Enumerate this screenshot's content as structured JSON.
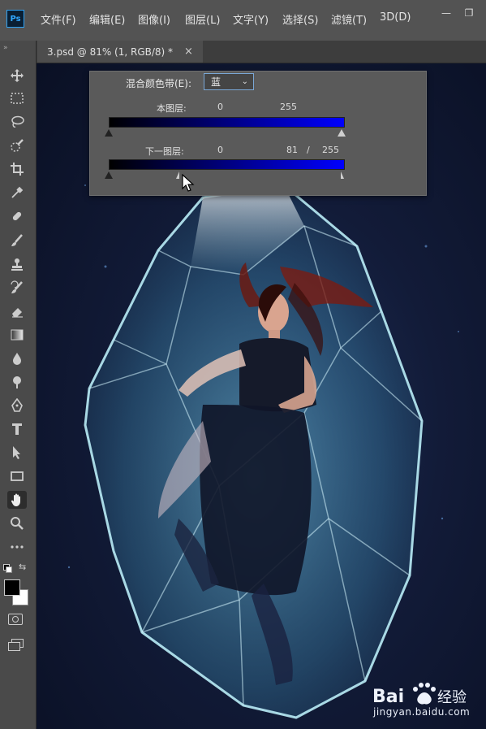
{
  "app": {
    "logo": "Ps"
  },
  "menu": {
    "items": [
      "文件(F)",
      "编辑(E)",
      "图像(I)",
      "图层(L)",
      "文字(Y)",
      "选择(S)",
      "滤镜(T)",
      "3D(D)"
    ]
  },
  "window_controls": {
    "minimize": "—",
    "restore": "❐"
  },
  "tabs": [
    {
      "label": "3.psd @ 81% (1, RGB/8) *",
      "close": "×"
    }
  ],
  "toolbar": {
    "expand": "»",
    "tools": [
      "move-icon",
      "marquee-icon",
      "lasso-icon",
      "quick-select-icon",
      "crop-icon",
      "eyedropper-icon",
      "healing-brush-icon",
      "brush-icon",
      "stamp-icon",
      "history-brush-icon",
      "eraser-icon",
      "gradient-icon",
      "blur-icon",
      "dodge-icon",
      "pen-icon",
      "type-icon",
      "path-select-icon",
      "rectangle-icon",
      "hand-icon",
      "zoom-icon",
      "more-icon"
    ],
    "active_tool": "hand-icon",
    "foreground_color": "#000000",
    "background_color": "#ffffff"
  },
  "blend_if": {
    "label": "混合颜色带(E):",
    "channel": "蓝",
    "this_layer": {
      "label": "本图层:",
      "low": "0",
      "high": "255"
    },
    "underlying_layer": {
      "label": "下一图层:",
      "low": "0",
      "high_split": "81",
      "separator": "/",
      "high": "255"
    },
    "gradient_start": "#000000",
    "gradient_end": "#0000ff"
  },
  "watermark": {
    "brand": "Bai 经验",
    "url": "jingyan.baidu.com"
  }
}
